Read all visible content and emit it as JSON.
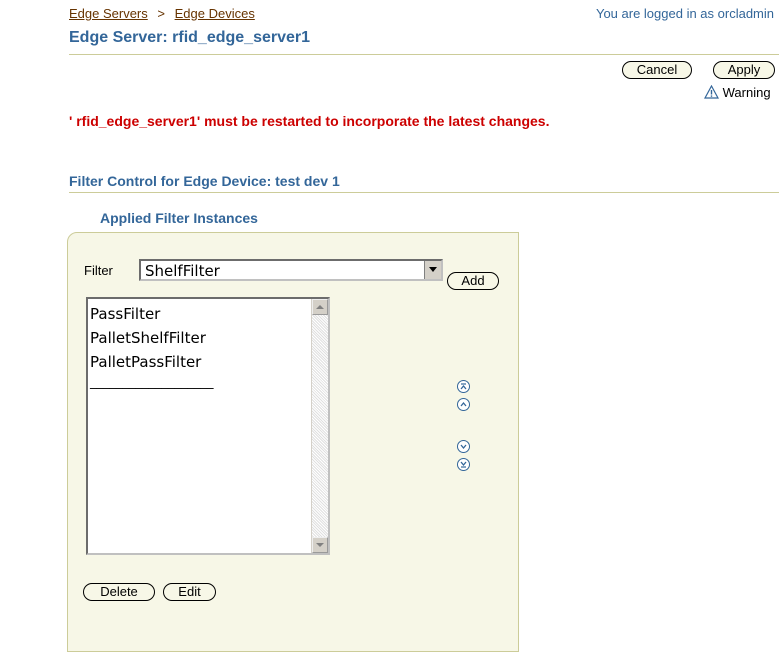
{
  "breadcrumb": {
    "items": [
      "Edge Servers",
      "Edge Devices"
    ],
    "separator": ">"
  },
  "login_text": "You are logged in as orcladmin",
  "page_title": "Edge Server: rfid_edge_server1",
  "buttons": {
    "cancel": "Cancel",
    "apply": "Apply"
  },
  "warning_label": "Warning",
  "warning_message": "' rfid_edge_server1' must be restarted to incorporate the latest changes.",
  "filter_control_header": "Filter Control for Edge Device: test dev 1",
  "applied_header": "Applied Filter Instances",
  "filter_label": "Filter",
  "filter_selected": "ShelfFilter",
  "add_button": "Add",
  "applied_list": [
    "PassFilter",
    "PalletShelfFilter",
    "PalletPassFilter",
    "___________________"
  ],
  "delete_button": "Delete",
  "edit_button": "Edit",
  "colors": {
    "accent": "#336699",
    "link": "#663300",
    "error": "#cc0000",
    "panel_bg": "#f7f7e7",
    "rule": "#cccc99"
  },
  "icons": {
    "warning": "warning-icon",
    "move_top": "move-to-top-icon",
    "move_up": "move-up-icon",
    "move_down": "move-down-icon",
    "move_bottom": "move-to-bottom-icon"
  }
}
